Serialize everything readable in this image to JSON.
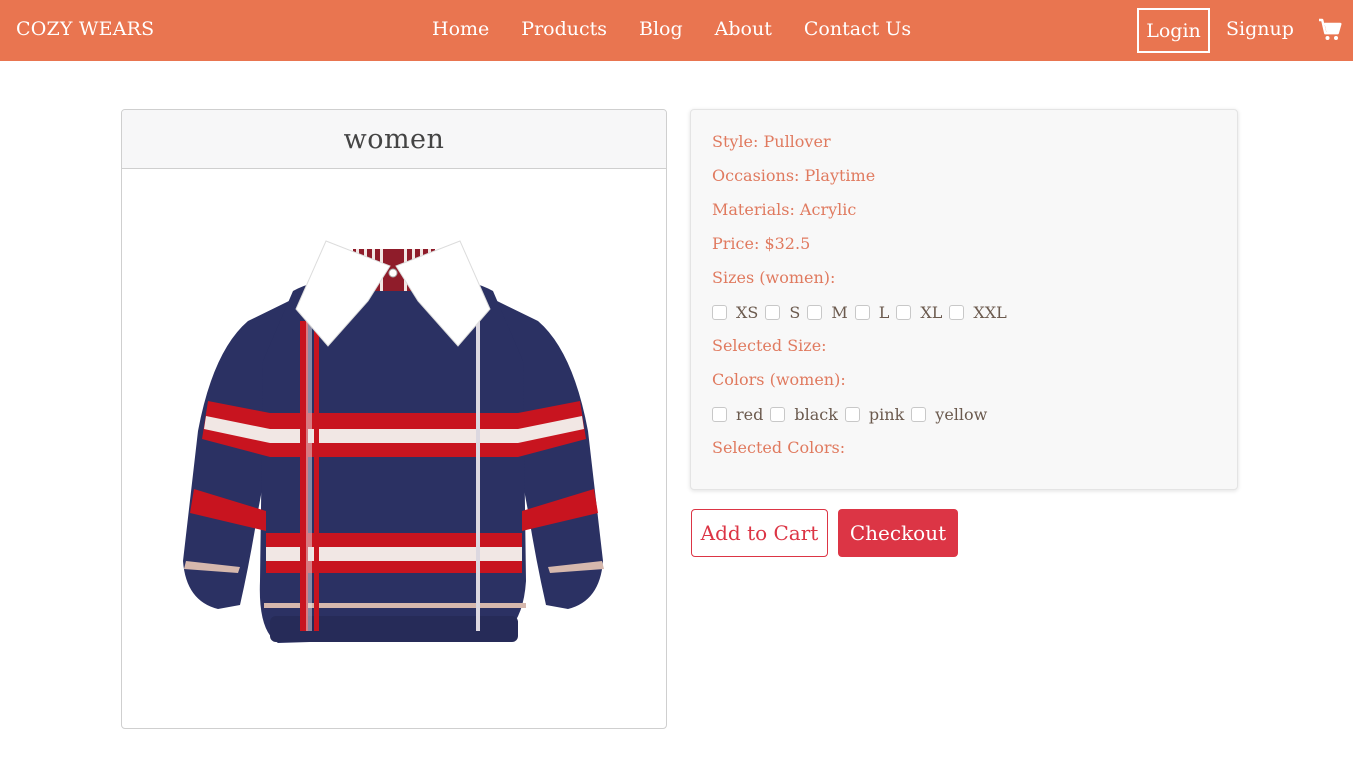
{
  "navbar": {
    "brand": "COZY WEARS",
    "links": [
      "Home",
      "Products",
      "Blog",
      "About",
      "Contact Us"
    ],
    "login_label": "Login",
    "signup_label": "Signup",
    "cart_icon": "shopping-cart-icon",
    "bg_color": "#e97550"
  },
  "product": {
    "category_title": "women",
    "style": "Style: Pullover",
    "occasions": "Occasions: Playtime",
    "materials": "Materials: Acrylic",
    "price": "Price: $32.5",
    "sizes_heading": "Sizes (women):",
    "sizes": [
      "XS",
      "S",
      "M",
      "L",
      "XL",
      "XXL"
    ],
    "selected_size_label": "Selected Size:",
    "colors_heading": "Colors (women):",
    "colors": [
      "red",
      "black",
      "pink",
      "yellow"
    ],
    "selected_colors_label": "Selected Colors:",
    "accent_color": "#e07a5f"
  },
  "actions": {
    "add_to_cart": "Add to Cart",
    "checkout": "Checkout",
    "danger_color": "#dc3545"
  }
}
